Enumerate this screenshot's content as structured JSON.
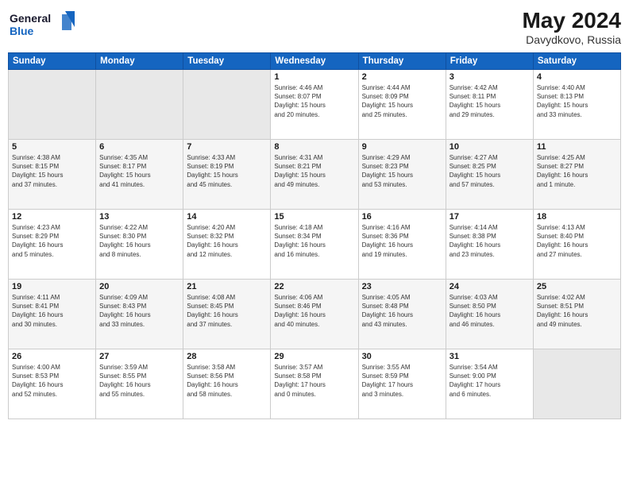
{
  "header": {
    "logo_line1": "General",
    "logo_line2": "Blue",
    "month_year": "May 2024",
    "location": "Davydkovo, Russia"
  },
  "days_of_week": [
    "Sunday",
    "Monday",
    "Tuesday",
    "Wednesday",
    "Thursday",
    "Friday",
    "Saturday"
  ],
  "weeks": [
    [
      {
        "day": "",
        "info": ""
      },
      {
        "day": "",
        "info": ""
      },
      {
        "day": "",
        "info": ""
      },
      {
        "day": "1",
        "info": "Sunrise: 4:46 AM\nSunset: 8:07 PM\nDaylight: 15 hours\nand 20 minutes."
      },
      {
        "day": "2",
        "info": "Sunrise: 4:44 AM\nSunset: 8:09 PM\nDaylight: 15 hours\nand 25 minutes."
      },
      {
        "day": "3",
        "info": "Sunrise: 4:42 AM\nSunset: 8:11 PM\nDaylight: 15 hours\nand 29 minutes."
      },
      {
        "day": "4",
        "info": "Sunrise: 4:40 AM\nSunset: 8:13 PM\nDaylight: 15 hours\nand 33 minutes."
      }
    ],
    [
      {
        "day": "5",
        "info": "Sunrise: 4:38 AM\nSunset: 8:15 PM\nDaylight: 15 hours\nand 37 minutes."
      },
      {
        "day": "6",
        "info": "Sunrise: 4:35 AM\nSunset: 8:17 PM\nDaylight: 15 hours\nand 41 minutes."
      },
      {
        "day": "7",
        "info": "Sunrise: 4:33 AM\nSunset: 8:19 PM\nDaylight: 15 hours\nand 45 minutes."
      },
      {
        "day": "8",
        "info": "Sunrise: 4:31 AM\nSunset: 8:21 PM\nDaylight: 15 hours\nand 49 minutes."
      },
      {
        "day": "9",
        "info": "Sunrise: 4:29 AM\nSunset: 8:23 PM\nDaylight: 15 hours\nand 53 minutes."
      },
      {
        "day": "10",
        "info": "Sunrise: 4:27 AM\nSunset: 8:25 PM\nDaylight: 15 hours\nand 57 minutes."
      },
      {
        "day": "11",
        "info": "Sunrise: 4:25 AM\nSunset: 8:27 PM\nDaylight: 16 hours\nand 1 minute."
      }
    ],
    [
      {
        "day": "12",
        "info": "Sunrise: 4:23 AM\nSunset: 8:29 PM\nDaylight: 16 hours\nand 5 minutes."
      },
      {
        "day": "13",
        "info": "Sunrise: 4:22 AM\nSunset: 8:30 PM\nDaylight: 16 hours\nand 8 minutes."
      },
      {
        "day": "14",
        "info": "Sunrise: 4:20 AM\nSunset: 8:32 PM\nDaylight: 16 hours\nand 12 minutes."
      },
      {
        "day": "15",
        "info": "Sunrise: 4:18 AM\nSunset: 8:34 PM\nDaylight: 16 hours\nand 16 minutes."
      },
      {
        "day": "16",
        "info": "Sunrise: 4:16 AM\nSunset: 8:36 PM\nDaylight: 16 hours\nand 19 minutes."
      },
      {
        "day": "17",
        "info": "Sunrise: 4:14 AM\nSunset: 8:38 PM\nDaylight: 16 hours\nand 23 minutes."
      },
      {
        "day": "18",
        "info": "Sunrise: 4:13 AM\nSunset: 8:40 PM\nDaylight: 16 hours\nand 27 minutes."
      }
    ],
    [
      {
        "day": "19",
        "info": "Sunrise: 4:11 AM\nSunset: 8:41 PM\nDaylight: 16 hours\nand 30 minutes."
      },
      {
        "day": "20",
        "info": "Sunrise: 4:09 AM\nSunset: 8:43 PM\nDaylight: 16 hours\nand 33 minutes."
      },
      {
        "day": "21",
        "info": "Sunrise: 4:08 AM\nSunset: 8:45 PM\nDaylight: 16 hours\nand 37 minutes."
      },
      {
        "day": "22",
        "info": "Sunrise: 4:06 AM\nSunset: 8:46 PM\nDaylight: 16 hours\nand 40 minutes."
      },
      {
        "day": "23",
        "info": "Sunrise: 4:05 AM\nSunset: 8:48 PM\nDaylight: 16 hours\nand 43 minutes."
      },
      {
        "day": "24",
        "info": "Sunrise: 4:03 AM\nSunset: 8:50 PM\nDaylight: 16 hours\nand 46 minutes."
      },
      {
        "day": "25",
        "info": "Sunrise: 4:02 AM\nSunset: 8:51 PM\nDaylight: 16 hours\nand 49 minutes."
      }
    ],
    [
      {
        "day": "26",
        "info": "Sunrise: 4:00 AM\nSunset: 8:53 PM\nDaylight: 16 hours\nand 52 minutes."
      },
      {
        "day": "27",
        "info": "Sunrise: 3:59 AM\nSunset: 8:55 PM\nDaylight: 16 hours\nand 55 minutes."
      },
      {
        "day": "28",
        "info": "Sunrise: 3:58 AM\nSunset: 8:56 PM\nDaylight: 16 hours\nand 58 minutes."
      },
      {
        "day": "29",
        "info": "Sunrise: 3:57 AM\nSunset: 8:58 PM\nDaylight: 17 hours\nand 0 minutes."
      },
      {
        "day": "30",
        "info": "Sunrise: 3:55 AM\nSunset: 8:59 PM\nDaylight: 17 hours\nand 3 minutes."
      },
      {
        "day": "31",
        "info": "Sunrise: 3:54 AM\nSunset: 9:00 PM\nDaylight: 17 hours\nand 6 minutes."
      },
      {
        "day": "",
        "info": ""
      }
    ]
  ]
}
